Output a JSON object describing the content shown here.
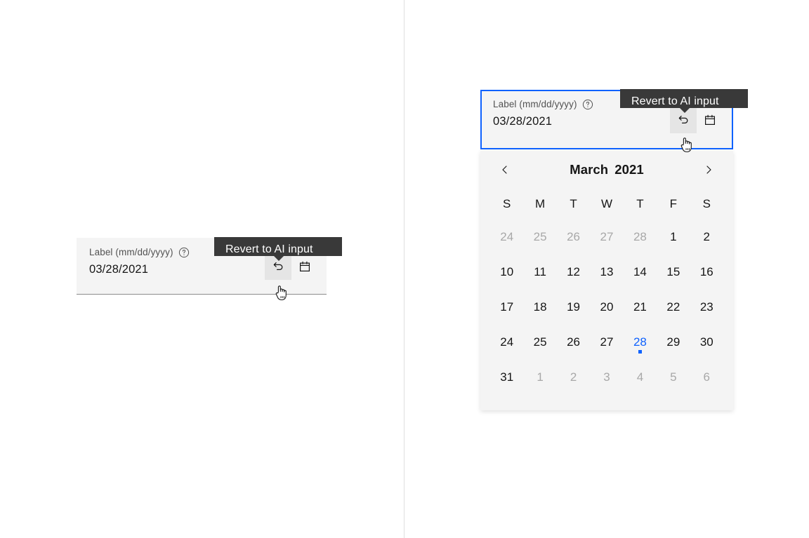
{
  "theme": {
    "accent_blue": "#0f62fe",
    "field_background": "#f4f4f4",
    "tooltip_background": "#393939",
    "text_primary": "#161616",
    "text_secondary": "#525252",
    "text_muted": "#a8a8a8",
    "divider": "#e0e0e0"
  },
  "variant_default": {
    "field": {
      "label": "Label (mm/dd/yyyy)",
      "value": "03/28/2021",
      "help_icon": "help-circle-icon",
      "revert_icon": "undo-icon",
      "calendar_icon": "calendar-icon"
    },
    "tooltip": {
      "text": "Revert to AI input"
    }
  },
  "variant_focused": {
    "field": {
      "label": "Label (mm/dd/yyyy)",
      "value": "03/28/2021",
      "help_icon": "help-circle-icon",
      "revert_icon": "undo-icon",
      "calendar_icon": "calendar-icon"
    },
    "tooltip": {
      "text": "Revert to AI input"
    },
    "calendar": {
      "prev_icon": "chevron-left-icon",
      "next_icon": "chevron-right-icon",
      "month": "March",
      "year": "2021",
      "weekdays": [
        "S",
        "M",
        "T",
        "W",
        "T",
        "F",
        "S"
      ],
      "weeks": [
        [
          {
            "day": "24",
            "muted": true,
            "selected": false
          },
          {
            "day": "25",
            "muted": true,
            "selected": false
          },
          {
            "day": "26",
            "muted": true,
            "selected": false
          },
          {
            "day": "27",
            "muted": true,
            "selected": false
          },
          {
            "day": "28",
            "muted": true,
            "selected": false
          },
          {
            "day": "1",
            "muted": false,
            "selected": false
          },
          {
            "day": "2",
            "muted": false,
            "selected": false
          }
        ],
        [
          {
            "day": "10",
            "muted": false,
            "selected": false
          },
          {
            "day": "11",
            "muted": false,
            "selected": false
          },
          {
            "day": "12",
            "muted": false,
            "selected": false
          },
          {
            "day": "13",
            "muted": false,
            "selected": false
          },
          {
            "day": "14",
            "muted": false,
            "selected": false
          },
          {
            "day": "15",
            "muted": false,
            "selected": false
          },
          {
            "day": "16",
            "muted": false,
            "selected": false
          }
        ],
        [
          {
            "day": "17",
            "muted": false,
            "selected": false
          },
          {
            "day": "18",
            "muted": false,
            "selected": false
          },
          {
            "day": "19",
            "muted": false,
            "selected": false
          },
          {
            "day": "20",
            "muted": false,
            "selected": false
          },
          {
            "day": "21",
            "muted": false,
            "selected": false
          },
          {
            "day": "22",
            "muted": false,
            "selected": false
          },
          {
            "day": "23",
            "muted": false,
            "selected": false
          }
        ],
        [
          {
            "day": "24",
            "muted": false,
            "selected": false
          },
          {
            "day": "25",
            "muted": false,
            "selected": false
          },
          {
            "day": "26",
            "muted": false,
            "selected": false
          },
          {
            "day": "27",
            "muted": false,
            "selected": false
          },
          {
            "day": "28",
            "muted": false,
            "selected": true
          },
          {
            "day": "29",
            "muted": false,
            "selected": false
          },
          {
            "day": "30",
            "muted": false,
            "selected": false
          }
        ],
        [
          {
            "day": "31",
            "muted": false,
            "selected": false
          },
          {
            "day": "1",
            "muted": true,
            "selected": false
          },
          {
            "day": "2",
            "muted": true,
            "selected": false
          },
          {
            "day": "3",
            "muted": true,
            "selected": false
          },
          {
            "day": "4",
            "muted": true,
            "selected": false
          },
          {
            "day": "5",
            "muted": true,
            "selected": false
          },
          {
            "day": "6",
            "muted": true,
            "selected": false
          }
        ]
      ]
    }
  }
}
